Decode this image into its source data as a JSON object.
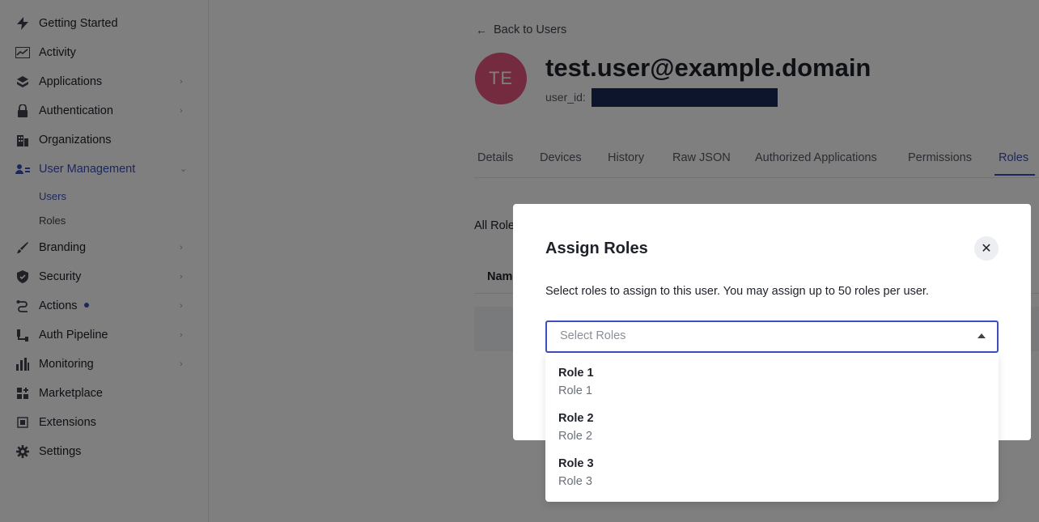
{
  "sidebar": {
    "items": [
      {
        "label": "Getting Started",
        "icon": "lightning-icon"
      },
      {
        "label": "Activity",
        "icon": "activity-chart-icon"
      },
      {
        "label": "Applications",
        "icon": "layers-icon"
      },
      {
        "label": "Authentication",
        "icon": "lock-icon"
      },
      {
        "label": "Organizations",
        "icon": "building-icon"
      },
      {
        "label": "User Management",
        "icon": "users-icon"
      },
      {
        "label": "Branding",
        "icon": "brush-icon"
      },
      {
        "label": "Security",
        "icon": "shield-icon"
      },
      {
        "label": "Actions",
        "icon": "actions-flow-icon"
      },
      {
        "label": "Auth Pipeline",
        "icon": "pipeline-icon"
      },
      {
        "label": "Monitoring",
        "icon": "bar-chart-icon"
      },
      {
        "label": "Marketplace",
        "icon": "marketplace-icon"
      },
      {
        "label": "Extensions",
        "icon": "extensions-icon"
      },
      {
        "label": "Settings",
        "icon": "gear-icon"
      }
    ],
    "sub_items": [
      {
        "label": "Users"
      },
      {
        "label": "Roles"
      }
    ]
  },
  "main": {
    "back_label": "Back to Users",
    "avatar_initials": "TE",
    "user_title": "test.user@example.domain",
    "user_id_label": "user_id:",
    "tabs": [
      {
        "label": "Details"
      },
      {
        "label": "Devices"
      },
      {
        "label": "History"
      },
      {
        "label": "Raw JSON"
      },
      {
        "label": "Authorized Applications"
      },
      {
        "label": "Permissions"
      },
      {
        "label": "Roles"
      }
    ],
    "all_roles_label": "All Roles",
    "table_col_name": "Name"
  },
  "modal": {
    "title": "Assign Roles",
    "description": "Select roles to assign to this user. You may assign up to 50 roles per user.",
    "select_placeholder": "Select Roles",
    "options": [
      {
        "name": "Role 1",
        "description": "Role 1"
      },
      {
        "name": "Role 2",
        "description": "Role 2"
      },
      {
        "name": "Role 3",
        "description": "Role 3"
      }
    ]
  },
  "colors": {
    "accent": "#3d4fb8",
    "avatar": "#e8547f",
    "redaction": "#1a2a5a"
  }
}
